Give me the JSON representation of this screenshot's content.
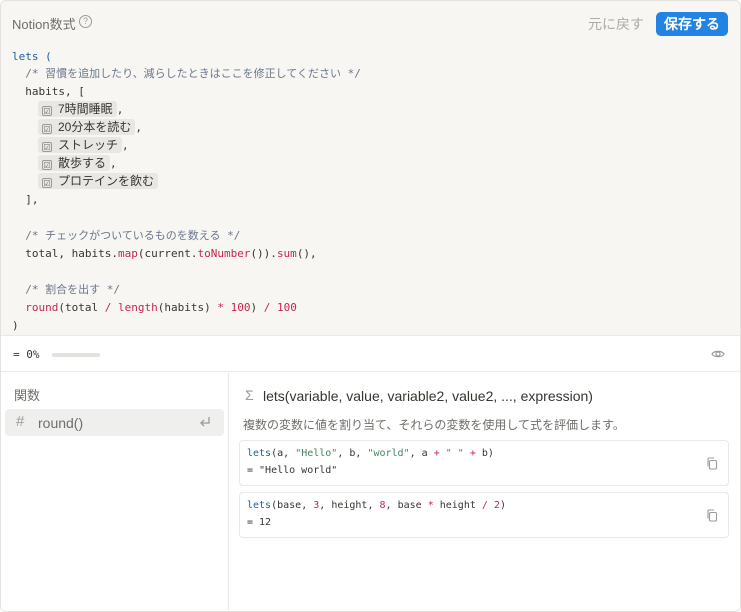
{
  "header": {
    "title": "Notion数式",
    "help_icon": "?",
    "revert_label": "元に戻す",
    "save_label": "保存する",
    "accent_color": "#2383e2"
  },
  "editor": {
    "l1": "lets (",
    "l2": "  /* 習慣を追加したり、減らしたときはここを修正してください */",
    "l3": "  habits, [",
    "habits": [
      {
        "checkbox": "☑",
        "label": "7時間睡眠",
        "sep": ","
      },
      {
        "checkbox": "☑",
        "label": "20分本を読む",
        "sep": ","
      },
      {
        "checkbox": "☑",
        "label": "ストレッチ",
        "sep": ","
      },
      {
        "checkbox": "☑",
        "label": "散歩する",
        "sep": ","
      },
      {
        "checkbox": "☑",
        "label": "プロテインを飲む",
        "sep": ""
      }
    ],
    "l9": "  ],",
    "l11": "  /* チェックがついているものを数える */",
    "l12": {
      "a": "  total, habits.",
      "map": "map",
      "b": "(current.",
      "tonum": "toNumber",
      "c": "()).",
      "sum": "sum",
      "d": "(),"
    },
    "l14": "  /* 割合を出す */",
    "l15": {
      "round": "round",
      "a": "(total ",
      "div": "/",
      "sp1": " ",
      "length": "length",
      "b": "(habits) ",
      "mul": "*",
      "sp2": " ",
      "hundred": "100",
      "c": ") ",
      "div2": "/",
      "sp3": " ",
      "hundred2": "100"
    },
    "l16": ")"
  },
  "result": {
    "text": "= 0%",
    "progress": 0,
    "eye_icon": "eye-icon"
  },
  "sidebar": {
    "heading": "関数",
    "items": [
      {
        "hash": "#",
        "label": "round()",
        "icon": "enter-icon"
      }
    ]
  },
  "doc": {
    "sigma": "Σ",
    "signature": "lets(variable, value, variable2, value2, ..., expression)",
    "description": "複数の変数に値を割り当て、それらの変数を使用して式を評価します。",
    "examples": [
      {
        "code": {
          "fn": "lets",
          "a": "(a, ",
          "s1": "\"Hello\"",
          "b": ", b, ",
          "s2": "\"world\"",
          "c": ", a ",
          "op1": "+",
          "d": " ",
          "s3": "\" \"",
          "e": " ",
          "op2": "+",
          "f": " b)"
        },
        "result": "= \"Hello world\""
      },
      {
        "code": {
          "fn": "lets",
          "a": "(base, ",
          "n1": "3",
          "b": ", height, ",
          "n2": "8",
          "c": ", base ",
          "op1": "*",
          "d": " height ",
          "op2": "/",
          "e": " ",
          "n3": "2",
          "f": ")"
        },
        "result": "= 12"
      }
    ]
  }
}
